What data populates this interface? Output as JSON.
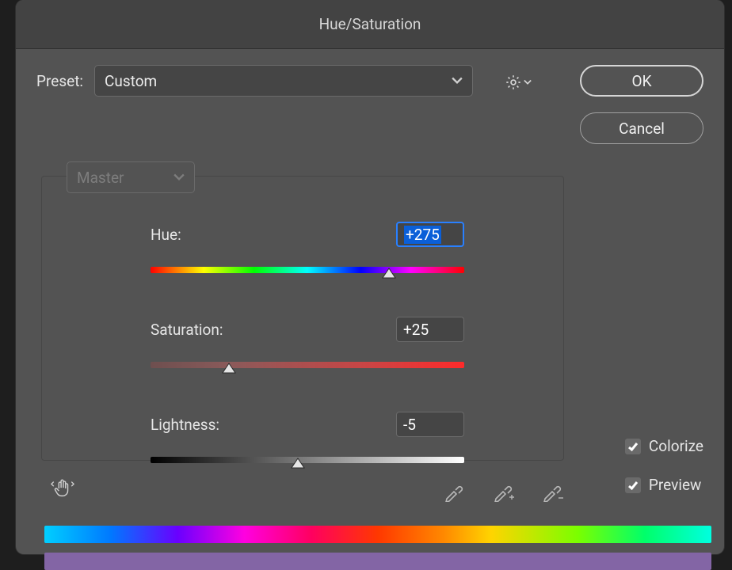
{
  "title": "Hue/Saturation",
  "preset": {
    "label": "Preset:",
    "value": "Custom"
  },
  "range": {
    "value": "Master"
  },
  "sliders": {
    "hue": {
      "label": "Hue:",
      "value": "+275",
      "percent": 76
    },
    "saturation": {
      "label": "Saturation:",
      "value": "+25",
      "percent": 25
    },
    "lightness": {
      "label": "Lightness:",
      "value": "-5",
      "percent": 47
    }
  },
  "buttons": {
    "ok": "OK",
    "cancel": "Cancel"
  },
  "checkboxes": {
    "colorize": {
      "label": "Colorize",
      "checked": true
    },
    "preview": {
      "label": "Preview",
      "checked": true
    }
  },
  "result_color": "#8365a5"
}
